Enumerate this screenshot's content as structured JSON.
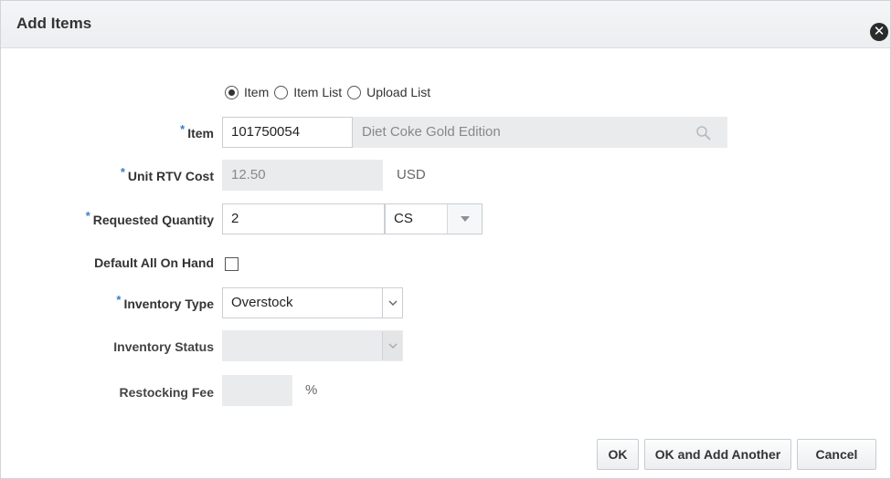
{
  "dialog": {
    "title": "Add Items",
    "close_icon_glyph": "✕"
  },
  "mode": {
    "options": [
      "Item",
      "Item List",
      "Upload List"
    ],
    "selected": "Item"
  },
  "form": {
    "required_marker": "*",
    "item": {
      "label": "Item",
      "value": "101750054",
      "description": "Diet Coke Gold Edition"
    },
    "unit_rtv_cost": {
      "label": "Unit RTV Cost",
      "value": "12.50",
      "currency": "USD"
    },
    "requested_quantity": {
      "label": "Requested Quantity",
      "value": "2",
      "uom": "CS"
    },
    "default_all_on_hand": {
      "label": "Default All On Hand",
      "checked": false
    },
    "inventory_type": {
      "label": "Inventory Type",
      "value": "Overstock"
    },
    "inventory_status": {
      "label": "Inventory Status",
      "value": ""
    },
    "restocking_fee": {
      "label": "Restocking Fee",
      "value": "",
      "unit": "%"
    }
  },
  "buttons": {
    "ok": "OK",
    "ok_add_another": "OK and Add Another",
    "cancel": "Cancel"
  },
  "colors": {
    "required_asterisk": "#3b7fc4",
    "readonly_bg": "#eaebec"
  }
}
